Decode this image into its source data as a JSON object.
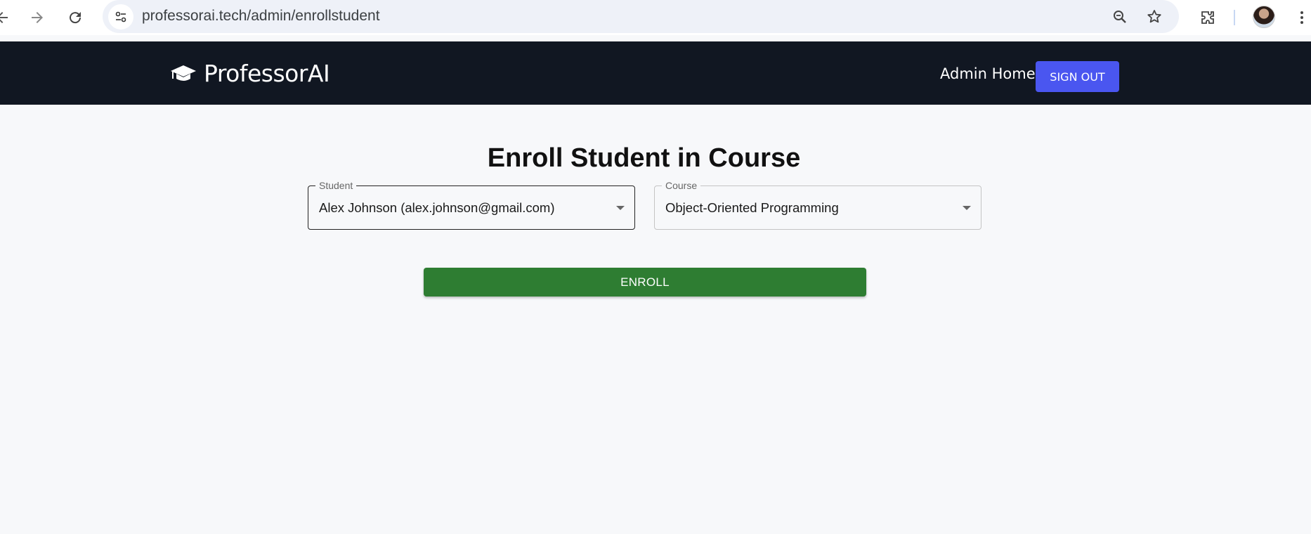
{
  "browser": {
    "url": "professorai.tech/admin/enrollstudent",
    "icons": [
      "back-icon",
      "forward-icon",
      "reload-icon",
      "site-info-icon",
      "zoom-icon",
      "bookmark-star-icon",
      "extensions-icon",
      "profile-avatar",
      "more-menu-icon"
    ]
  },
  "header": {
    "brand_name": "ProfessorAI",
    "brand_icon": "graduation-cap-icon",
    "admin_home_label": "Admin Home",
    "signout_label": "SIGN OUT"
  },
  "main": {
    "title": "Enroll Student in Course",
    "student_field": {
      "label": "Student",
      "value": "Alex Johnson (alex.johnson@gmail.com)"
    },
    "course_field": {
      "label": "Course",
      "value": "Object-Oriented Programming"
    },
    "enroll_label": "ENROLL"
  },
  "colors": {
    "header_bg": "#111722",
    "signout_bg": "#4a56f0",
    "enroll_bg": "#2e7d32",
    "page_bg": "#f7f8fa"
  }
}
